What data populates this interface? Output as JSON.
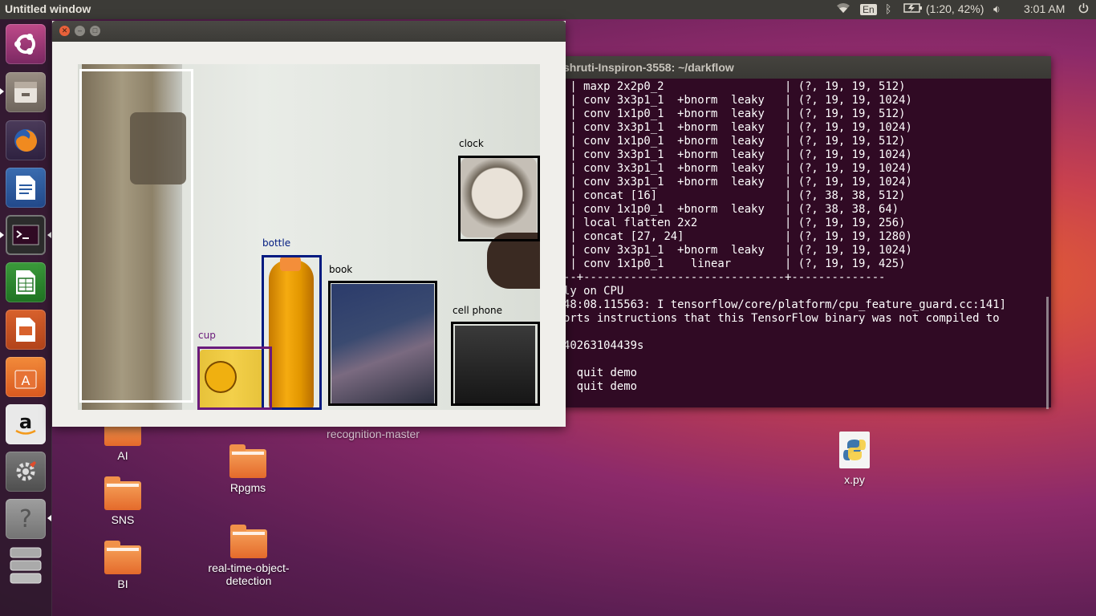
{
  "top_panel": {
    "window_title": "Untitled window",
    "keyboard_layout": "En",
    "battery": "(1:20, 42%)",
    "clock": "3:01 AM",
    "icons": [
      "wifi-icon",
      "bluetooth-icon",
      "battery-icon",
      "volume-icon",
      "power-icon"
    ]
  },
  "launcher": {
    "items": [
      "Ubuntu Dash",
      "Files",
      "Firefox",
      "LibreOffice Writer",
      "Terminal",
      "LibreOffice Calc",
      "LibreOffice Impress",
      "Ubuntu Software",
      "Amazon",
      "System Settings",
      "Help",
      "Trash"
    ]
  },
  "desktop": {
    "icons": [
      {
        "label": "AI"
      },
      {
        "label": "SNS"
      },
      {
        "label": "BI"
      },
      {
        "label": "Rpgms"
      },
      {
        "label": "real-time-object-detection"
      },
      {
        "label": "recognition-master"
      },
      {
        "label": "x.py"
      }
    ]
  },
  "terminal": {
    "title": "shruti-Inspiron-3558: ~/darkflow",
    "lines": [
      " | maxp 2x2p0_2                  | (?, 19, 19, 512)",
      " | conv 3x3p1_1  +bnorm  leaky   | (?, 19, 19, 1024)",
      " | conv 1x1p0_1  +bnorm  leaky   | (?, 19, 19, 512)",
      " | conv 3x3p1_1  +bnorm  leaky   | (?, 19, 19, 1024)",
      " | conv 1x1p0_1  +bnorm  leaky   | (?, 19, 19, 512)",
      " | conv 3x3p1_1  +bnorm  leaky   | (?, 19, 19, 1024)",
      " | conv 3x3p1_1  +bnorm  leaky   | (?, 19, 19, 1024)",
      " | conv 3x3p1_1  +bnorm  leaky   | (?, 19, 19, 1024)",
      " | concat [16]                   | (?, 38, 38, 512)",
      " | conv 1x1p0_1  +bnorm  leaky   | (?, 38, 38, 64)",
      " | local flatten 2x2             | (?, 19, 19, 256)",
      " | concat [27, 24]               | (?, 19, 19, 1280)",
      " | conv 3x3p1_1  +bnorm  leaky   | (?, 19, 19, 1024)",
      " | conv 1x1p0_1    linear        | (?, 19, 19, 425)",
      "--+------------------------------+--------------",
      "ly on CPU",
      "48:08.115563: I tensorflow/core/platform/cpu_feature_guard.cc:141]",
      "orts instructions that this TensorFlow binary was not compiled to",
      "",
      "40263104439s",
      "",
      "  quit demo",
      "  quit demo"
    ]
  },
  "output_window": {
    "detections": [
      {
        "label": "",
        "color": "#ffffff"
      },
      {
        "label": "clock",
        "color": "#000000"
      },
      {
        "label": "bottle",
        "color": "#001a80"
      },
      {
        "label": "book",
        "color": "#000000"
      },
      {
        "label": "cell phone",
        "color": "#000000"
      },
      {
        "label": "cup",
        "color": "#6a1a7a"
      }
    ]
  }
}
